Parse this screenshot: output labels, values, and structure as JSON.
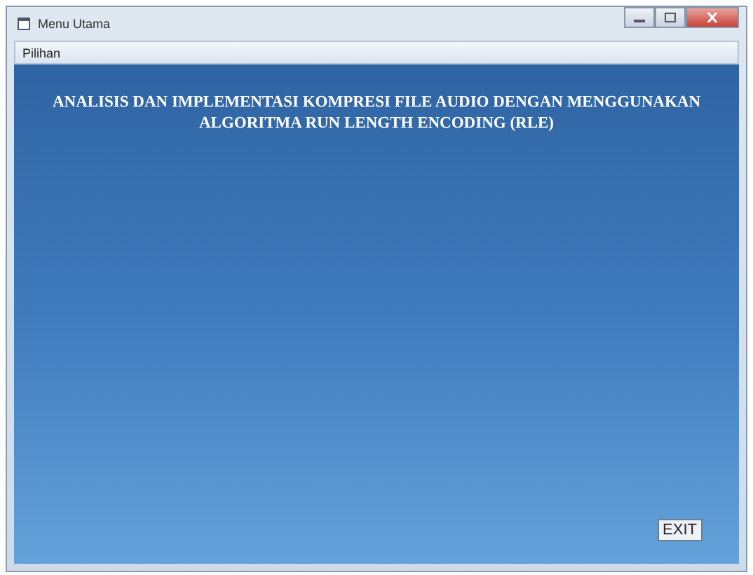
{
  "window": {
    "title": "Menu Utama"
  },
  "menu": [
    "Pilihan"
  ],
  "heading": "ANALISIS DAN IMPLEMENTASI KOMPRESI FILE AUDIO DENGAN MENGGUNAKAN ALGORITMA RUN LENGTH ENCODING (RLE)",
  "exit_button": "EXIT"
}
